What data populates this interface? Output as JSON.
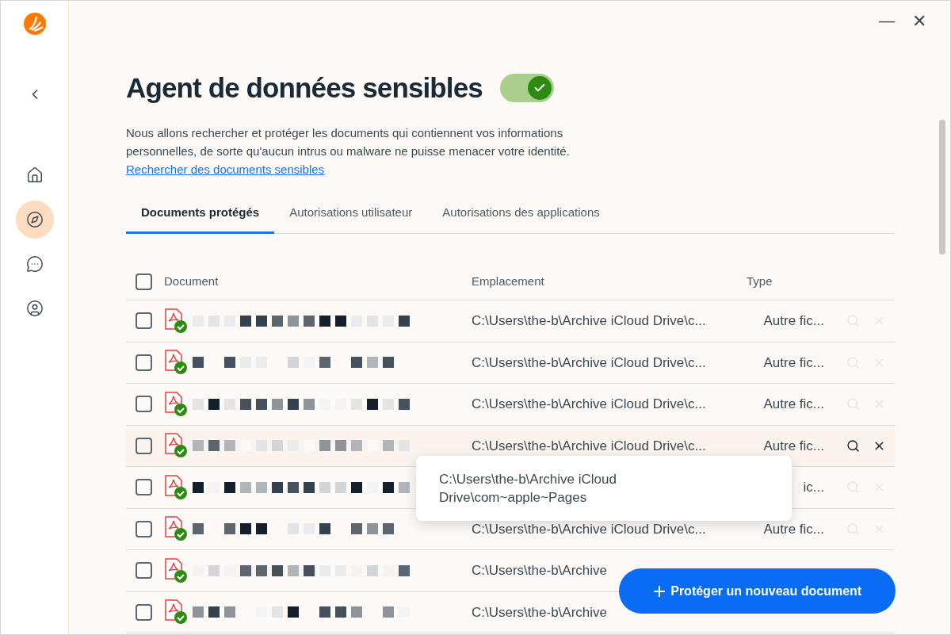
{
  "window": {
    "minimize": "—",
    "close": "✕"
  },
  "header": {
    "title": "Agent de données sensibles",
    "enabled": true,
    "description": "Nous allons rechercher et protéger les documents qui contiennent vos informations personnelles, de sorte qu'aucun intrus ou malware ne puisse menacer votre identité.",
    "link": "Rechercher des documents sensibles"
  },
  "sidebar": {
    "items": [
      {
        "kind": "home",
        "selected": false
      },
      {
        "kind": "compass",
        "selected": true
      },
      {
        "kind": "chat",
        "selected": false
      },
      {
        "kind": "account",
        "selected": false
      }
    ]
  },
  "tabs": [
    {
      "label": "Documents protégés",
      "selected": true
    },
    {
      "label": "Autorisations utilisateur",
      "selected": false
    },
    {
      "label": "Autorisations des applications",
      "selected": false
    }
  ],
  "table": {
    "columns": [
      "Document",
      "Emplacement",
      "Type"
    ],
    "all_checked": false,
    "rows": [
      {
        "checked": false,
        "location": "C:\\Users\\the-b\\Archive iCloud Drive\\c...",
        "type": "Autre fic...",
        "hovered": false
      },
      {
        "checked": false,
        "location": "C:\\Users\\the-b\\Archive iCloud Drive\\c...",
        "type": "Autre fic...",
        "hovered": false
      },
      {
        "checked": false,
        "location": "C:\\Users\\the-b\\Archive iCloud Drive\\c...",
        "type": "Autre fic...",
        "hovered": false
      },
      {
        "checked": false,
        "location": "C:\\Users\\the-b\\Archive iCloud Drive\\c...",
        "type": "Autre fic...",
        "hovered": true
      },
      {
        "checked": false,
        "type": "ic...",
        "hovered": false
      },
      {
        "checked": false,
        "location": "C:\\Users\\the-b\\Archive iCloud Drive\\c...",
        "type": "Autre fic...",
        "hovered": false
      },
      {
        "checked": false,
        "location": "C:\\Users\\the-b\\Archive"
      },
      {
        "checked": false,
        "location": "C:\\Users\\the-b\\Archive"
      }
    ]
  },
  "tooltip": "C:\\Users\\the-b\\Archive iCloud Drive\\com~apple~Pages",
  "add_button": {
    "icon": "+",
    "label": "Protéger un nouveau document"
  }
}
